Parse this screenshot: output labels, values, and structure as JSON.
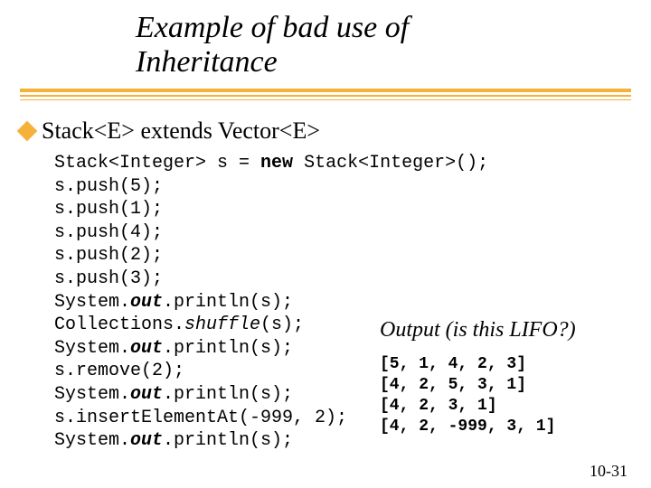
{
  "title": {
    "line1": "Example of bad use of",
    "line2": "Inheritance"
  },
  "bullet": "Stack<E> extends Vector<E>",
  "code": {
    "l1_a": "Stack<Integer> s = ",
    "l1_kw": "new",
    "l1_b": " Stack<Integer>();",
    "l2": "s.push(5);",
    "l3": "s.push(1);",
    "l4": "s.push(4);",
    "l5": "s.push(2);",
    "l6": "s.push(3);",
    "l7_a": "System.",
    "l7_em": "out",
    "l7_b": ".println(s);",
    "l8_a": "Collections.",
    "l8_em": "shuffle",
    "l8_b": "(s);",
    "l9_a": "System.",
    "l9_em": "out",
    "l9_b": ".println(s);",
    "l10": "s.remove(2);",
    "l11_a": "System.",
    "l11_em": "out",
    "l11_b": ".println(s);",
    "l12": "s.insertElementAt(-999, 2);",
    "l13_a": "System.",
    "l13_em": "out",
    "l13_b": ".println(s);"
  },
  "output_label": "Output  (is this LIFO?)",
  "output": {
    "o1": "[5, 1, 4, 2, 3]",
    "o2": "[4, 2, 5, 3, 1]",
    "o3": "[4, 2, 3, 1]",
    "o4": "[4, 2, -999, 3, 1]"
  },
  "page": "10-31"
}
